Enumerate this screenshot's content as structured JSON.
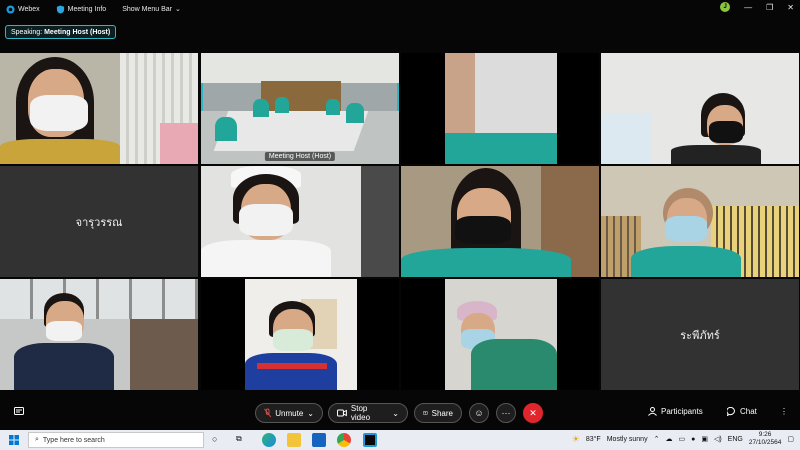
{
  "titlebar": {
    "app_name": "Webex",
    "meeting_info": "Meeting Info",
    "show_menu_bar": "Show Menu Bar",
    "user_initial": "J"
  },
  "speaking": {
    "prefix": "Speaking:",
    "name": "Meeting Host (Host)"
  },
  "tiles": {
    "host_label": "Meeting Host  (Host)",
    "name_1": "จารุวรรณ",
    "name_2": "ระพีภัทร์"
  },
  "controls": {
    "unmute": "Unmute",
    "stop_video": "Stop video",
    "share": "Share",
    "more": "···",
    "participants": "Participants",
    "chat": "Chat"
  },
  "taskbar": {
    "search_placeholder": "Type here to search",
    "weather_temp": "83°F",
    "weather_desc": "Mostly sunny",
    "lang": "ENG",
    "time": "9:26",
    "date": "27/10/2564"
  },
  "colors": {
    "accent": "#2fb6c4",
    "end_call": "#e0262c"
  }
}
